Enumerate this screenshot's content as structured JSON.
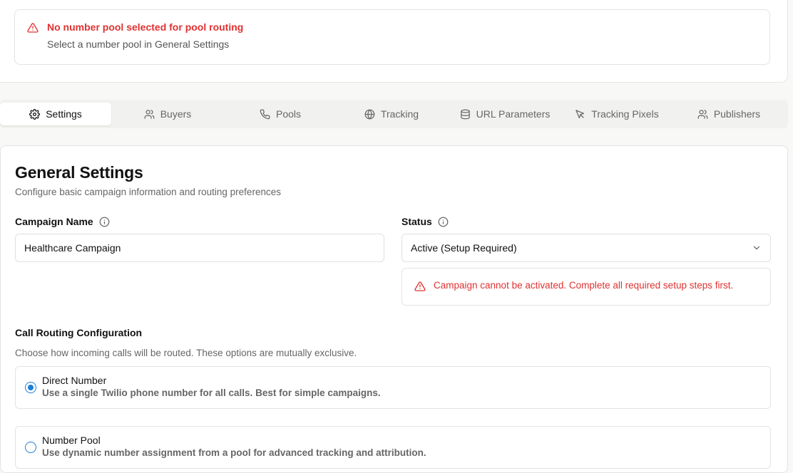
{
  "alert": {
    "title": "No number pool selected for pool routing",
    "description": "Select a number pool in General Settings"
  },
  "tabs": [
    {
      "label": "Settings",
      "icon": "gear-icon",
      "active": true
    },
    {
      "label": "Buyers",
      "icon": "users-icon"
    },
    {
      "label": "Pools",
      "icon": "phone-icon"
    },
    {
      "label": "Tracking",
      "icon": "globe-icon"
    },
    {
      "label": "URL Parameters",
      "icon": "database-icon"
    },
    {
      "label": "Tracking Pixels",
      "icon": "cursor-icon"
    },
    {
      "label": "Publishers",
      "icon": "users-icon"
    }
  ],
  "general": {
    "title": "General Settings",
    "subtitle": "Configure basic campaign information and routing preferences",
    "campaign_name_label": "Campaign Name",
    "campaign_name_value": "Healthcare Campaign",
    "status_label": "Status",
    "status_value": "Active (Setup Required)",
    "status_warning": "Campaign cannot be activated. Complete all required setup steps first."
  },
  "routing": {
    "title": "Call Routing Configuration",
    "subtitle": "Choose how incoming calls will be routed. These options are mutually exclusive.",
    "options": [
      {
        "title": "Direct Number",
        "description": "Use a single Twilio phone number for all calls. Best for simple campaigns.",
        "selected": true
      },
      {
        "title": "Number Pool",
        "description": "Use dynamic number assignment from a pool for advanced tracking and attribution.",
        "selected": false
      }
    ]
  },
  "colors": {
    "error": "#e03131",
    "accent": "#1c7ed6"
  }
}
